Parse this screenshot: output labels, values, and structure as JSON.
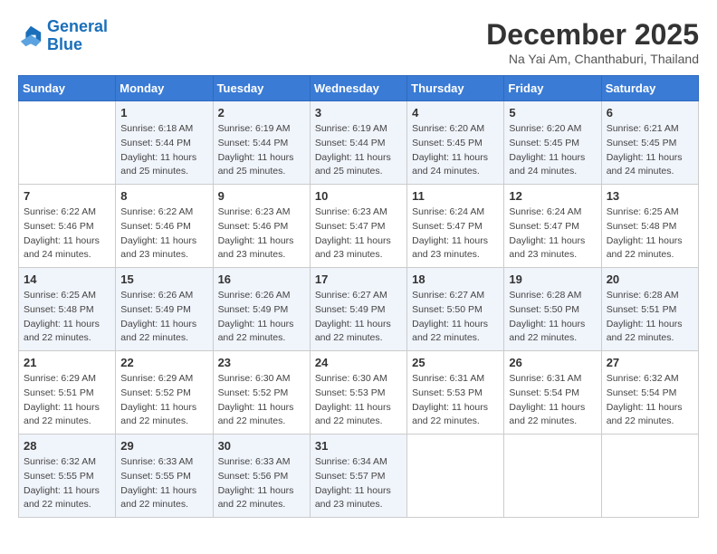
{
  "logo": {
    "line1": "General",
    "line2": "Blue"
  },
  "title": "December 2025",
  "location": "Na Yai Am, Chanthaburi, Thailand",
  "days_of_week": [
    "Sunday",
    "Monday",
    "Tuesday",
    "Wednesday",
    "Thursday",
    "Friday",
    "Saturday"
  ],
  "weeks": [
    [
      {
        "day": "",
        "sunrise": "",
        "sunset": "",
        "daylight": ""
      },
      {
        "day": "1",
        "sunrise": "Sunrise: 6:18 AM",
        "sunset": "Sunset: 5:44 PM",
        "daylight": "Daylight: 11 hours and 25 minutes."
      },
      {
        "day": "2",
        "sunrise": "Sunrise: 6:19 AM",
        "sunset": "Sunset: 5:44 PM",
        "daylight": "Daylight: 11 hours and 25 minutes."
      },
      {
        "day": "3",
        "sunrise": "Sunrise: 6:19 AM",
        "sunset": "Sunset: 5:44 PM",
        "daylight": "Daylight: 11 hours and 25 minutes."
      },
      {
        "day": "4",
        "sunrise": "Sunrise: 6:20 AM",
        "sunset": "Sunset: 5:45 PM",
        "daylight": "Daylight: 11 hours and 24 minutes."
      },
      {
        "day": "5",
        "sunrise": "Sunrise: 6:20 AM",
        "sunset": "Sunset: 5:45 PM",
        "daylight": "Daylight: 11 hours and 24 minutes."
      },
      {
        "day": "6",
        "sunrise": "Sunrise: 6:21 AM",
        "sunset": "Sunset: 5:45 PM",
        "daylight": "Daylight: 11 hours and 24 minutes."
      }
    ],
    [
      {
        "day": "7",
        "sunrise": "Sunrise: 6:22 AM",
        "sunset": "Sunset: 5:46 PM",
        "daylight": "Daylight: 11 hours and 24 minutes."
      },
      {
        "day": "8",
        "sunrise": "Sunrise: 6:22 AM",
        "sunset": "Sunset: 5:46 PM",
        "daylight": "Daylight: 11 hours and 23 minutes."
      },
      {
        "day": "9",
        "sunrise": "Sunrise: 6:23 AM",
        "sunset": "Sunset: 5:46 PM",
        "daylight": "Daylight: 11 hours and 23 minutes."
      },
      {
        "day": "10",
        "sunrise": "Sunrise: 6:23 AM",
        "sunset": "Sunset: 5:47 PM",
        "daylight": "Daylight: 11 hours and 23 minutes."
      },
      {
        "day": "11",
        "sunrise": "Sunrise: 6:24 AM",
        "sunset": "Sunset: 5:47 PM",
        "daylight": "Daylight: 11 hours and 23 minutes."
      },
      {
        "day": "12",
        "sunrise": "Sunrise: 6:24 AM",
        "sunset": "Sunset: 5:47 PM",
        "daylight": "Daylight: 11 hours and 23 minutes."
      },
      {
        "day": "13",
        "sunrise": "Sunrise: 6:25 AM",
        "sunset": "Sunset: 5:48 PM",
        "daylight": "Daylight: 11 hours and 22 minutes."
      }
    ],
    [
      {
        "day": "14",
        "sunrise": "Sunrise: 6:25 AM",
        "sunset": "Sunset: 5:48 PM",
        "daylight": "Daylight: 11 hours and 22 minutes."
      },
      {
        "day": "15",
        "sunrise": "Sunrise: 6:26 AM",
        "sunset": "Sunset: 5:49 PM",
        "daylight": "Daylight: 11 hours and 22 minutes."
      },
      {
        "day": "16",
        "sunrise": "Sunrise: 6:26 AM",
        "sunset": "Sunset: 5:49 PM",
        "daylight": "Daylight: 11 hours and 22 minutes."
      },
      {
        "day": "17",
        "sunrise": "Sunrise: 6:27 AM",
        "sunset": "Sunset: 5:49 PM",
        "daylight": "Daylight: 11 hours and 22 minutes."
      },
      {
        "day": "18",
        "sunrise": "Sunrise: 6:27 AM",
        "sunset": "Sunset: 5:50 PM",
        "daylight": "Daylight: 11 hours and 22 minutes."
      },
      {
        "day": "19",
        "sunrise": "Sunrise: 6:28 AM",
        "sunset": "Sunset: 5:50 PM",
        "daylight": "Daylight: 11 hours and 22 minutes."
      },
      {
        "day": "20",
        "sunrise": "Sunrise: 6:28 AM",
        "sunset": "Sunset: 5:51 PM",
        "daylight": "Daylight: 11 hours and 22 minutes."
      }
    ],
    [
      {
        "day": "21",
        "sunrise": "Sunrise: 6:29 AM",
        "sunset": "Sunset: 5:51 PM",
        "daylight": "Daylight: 11 hours and 22 minutes."
      },
      {
        "day": "22",
        "sunrise": "Sunrise: 6:29 AM",
        "sunset": "Sunset: 5:52 PM",
        "daylight": "Daylight: 11 hours and 22 minutes."
      },
      {
        "day": "23",
        "sunrise": "Sunrise: 6:30 AM",
        "sunset": "Sunset: 5:52 PM",
        "daylight": "Daylight: 11 hours and 22 minutes."
      },
      {
        "day": "24",
        "sunrise": "Sunrise: 6:30 AM",
        "sunset": "Sunset: 5:53 PM",
        "daylight": "Daylight: 11 hours and 22 minutes."
      },
      {
        "day": "25",
        "sunrise": "Sunrise: 6:31 AM",
        "sunset": "Sunset: 5:53 PM",
        "daylight": "Daylight: 11 hours and 22 minutes."
      },
      {
        "day": "26",
        "sunrise": "Sunrise: 6:31 AM",
        "sunset": "Sunset: 5:54 PM",
        "daylight": "Daylight: 11 hours and 22 minutes."
      },
      {
        "day": "27",
        "sunrise": "Sunrise: 6:32 AM",
        "sunset": "Sunset: 5:54 PM",
        "daylight": "Daylight: 11 hours and 22 minutes."
      }
    ],
    [
      {
        "day": "28",
        "sunrise": "Sunrise: 6:32 AM",
        "sunset": "Sunset: 5:55 PM",
        "daylight": "Daylight: 11 hours and 22 minutes."
      },
      {
        "day": "29",
        "sunrise": "Sunrise: 6:33 AM",
        "sunset": "Sunset: 5:55 PM",
        "daylight": "Daylight: 11 hours and 22 minutes."
      },
      {
        "day": "30",
        "sunrise": "Sunrise: 6:33 AM",
        "sunset": "Sunset: 5:56 PM",
        "daylight": "Daylight: 11 hours and 22 minutes."
      },
      {
        "day": "31",
        "sunrise": "Sunrise: 6:34 AM",
        "sunset": "Sunset: 5:57 PM",
        "daylight": "Daylight: 11 hours and 23 minutes."
      },
      {
        "day": "",
        "sunrise": "",
        "sunset": "",
        "daylight": ""
      },
      {
        "day": "",
        "sunrise": "",
        "sunset": "",
        "daylight": ""
      },
      {
        "day": "",
        "sunrise": "",
        "sunset": "",
        "daylight": ""
      }
    ]
  ]
}
